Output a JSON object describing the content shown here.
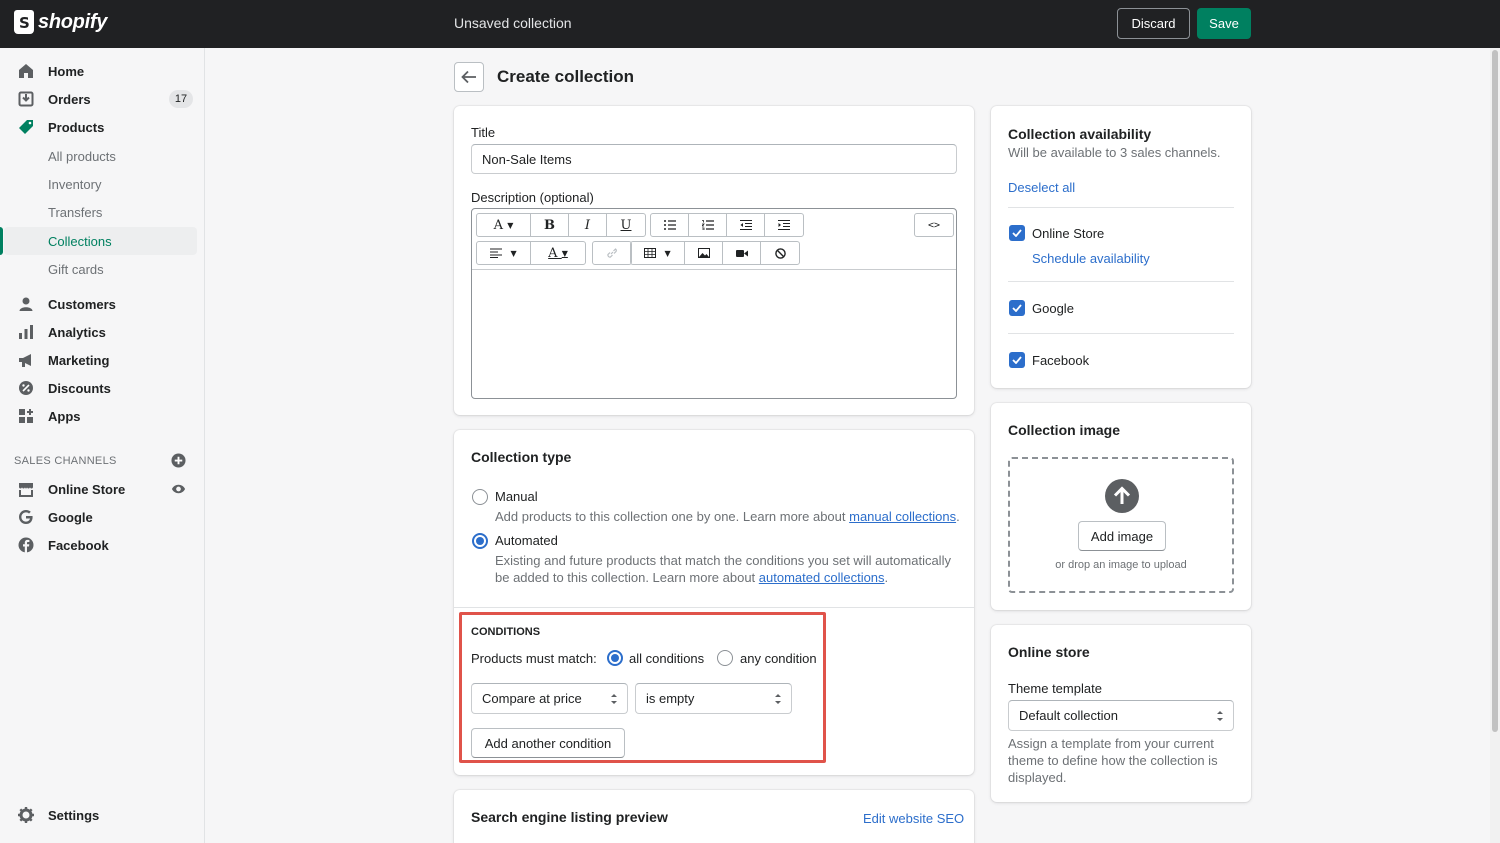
{
  "topbar": {
    "logo_text": "shopify",
    "title": "Unsaved collection",
    "discard_label": "Discard",
    "save_label": "Save"
  },
  "sidebar": {
    "items": [
      {
        "label": "Home",
        "icon": "home-icon"
      },
      {
        "label": "Orders",
        "icon": "orders-icon",
        "badge": "17"
      },
      {
        "label": "Products",
        "icon": "tag-icon"
      }
    ],
    "product_sub": [
      "All products",
      "Inventory",
      "Transfers",
      "Collections",
      "Gift cards"
    ],
    "items2": [
      {
        "label": "Customers",
        "icon": "person-icon"
      },
      {
        "label": "Analytics",
        "icon": "bar-chart-icon"
      },
      {
        "label": "Marketing",
        "icon": "megaphone-icon"
      },
      {
        "label": "Discounts",
        "icon": "discount-icon"
      },
      {
        "label": "Apps",
        "icon": "apps-icon"
      }
    ],
    "channels_heading": "SALES CHANNELS",
    "channels": [
      {
        "label": "Online Store",
        "icon": "store-icon"
      },
      {
        "label": "Google",
        "icon": "google-icon"
      },
      {
        "label": "Facebook",
        "icon": "facebook-icon"
      }
    ],
    "settings_label": "Settings"
  },
  "page": {
    "title": "Create collection"
  },
  "details": {
    "title_label": "Title",
    "title_value": "Non-Sale Items",
    "description_label": "Description (optional)"
  },
  "collection_type": {
    "heading": "Collection type",
    "manual_label": "Manual",
    "manual_help": "Add products to this collection one by one. Learn more about ",
    "manual_link": "manual collections",
    "automated_label": "Automated",
    "automated_help": "Existing and future products that match the conditions you set will automatically be added to this collection. Learn more about ",
    "automated_link": "automated collections",
    "period": "."
  },
  "conditions": {
    "heading": "CONDITIONS",
    "match_label": "Products must match:",
    "all_label": "all conditions",
    "any_label": "any condition",
    "field_value": "Compare at price",
    "operator_value": "is empty",
    "add_button": "Add another condition"
  },
  "seo": {
    "heading": "Search engine listing preview",
    "edit_link": "Edit website SEO"
  },
  "availability": {
    "heading": "Collection availability",
    "subtext": "Will be available to 3 sales channels.",
    "deselect_link": "Deselect all",
    "channels": [
      "Online Store",
      "Google",
      "Facebook"
    ],
    "schedule_link": "Schedule availability"
  },
  "image": {
    "heading": "Collection image",
    "add_button": "Add image",
    "drop_text": "or drop an image to upload"
  },
  "online_store": {
    "heading": "Online store",
    "template_label": "Theme template",
    "template_value": "Default collection",
    "help": "Assign a template from your current theme to define how the collection is displayed."
  },
  "colors": {
    "brand": "#008060",
    "accent": "#2c6ecb",
    "highlight": "#e0534a"
  }
}
